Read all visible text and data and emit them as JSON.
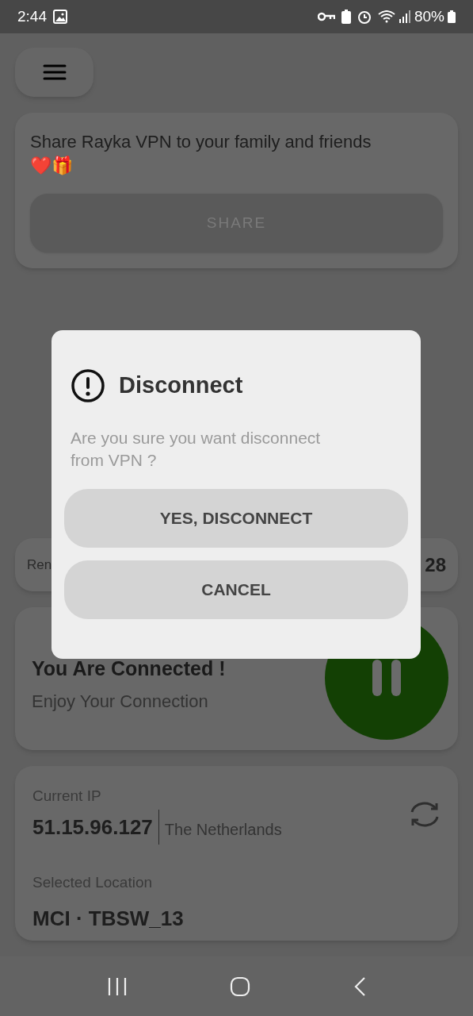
{
  "status_bar": {
    "time": "2:44",
    "battery": "80%"
  },
  "share_card": {
    "message": "Share Rayka VPN to your family and friends ❤️🎁",
    "button": "SHARE"
  },
  "remaining_card": {
    "label": "Ren",
    "value": "28"
  },
  "connection_card": {
    "title": "You Are Connected !",
    "subtitle": "Enjoy Your Connection",
    "connected": true
  },
  "ip_card": {
    "ip_label": "Current IP",
    "ip": "51.15.96.127",
    "country": "The Netherlands",
    "location_label": "Selected Location",
    "location": "MCI · TBSW_13"
  },
  "dialog": {
    "title": "Disconnect",
    "message": "Are you sure you want disconnect from VPN ?",
    "buttons": [
      "YES, DISCONNECT",
      "CANCEL"
    ]
  }
}
